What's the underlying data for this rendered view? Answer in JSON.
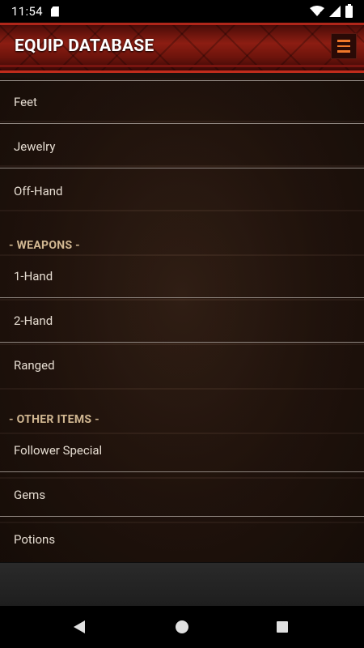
{
  "status_bar": {
    "time": "11:54"
  },
  "header": {
    "title": "EQUIP DATABASE",
    "menu_icon": "hamburger-icon",
    "accent_color": "#f0782a"
  },
  "list": {
    "items_top": [
      "Feet",
      "Jewelry",
      "Off-Hand"
    ],
    "weapons_header": "- WEAPONS -",
    "weapons": [
      "1-Hand",
      "2-Hand",
      "Ranged"
    ],
    "other_header": "- OTHER ITEMS -",
    "other": [
      "Follower Special",
      "Gems",
      "Potions"
    ]
  },
  "nav_bar": {
    "icons": [
      "back-icon",
      "home-icon",
      "recents-icon"
    ]
  }
}
